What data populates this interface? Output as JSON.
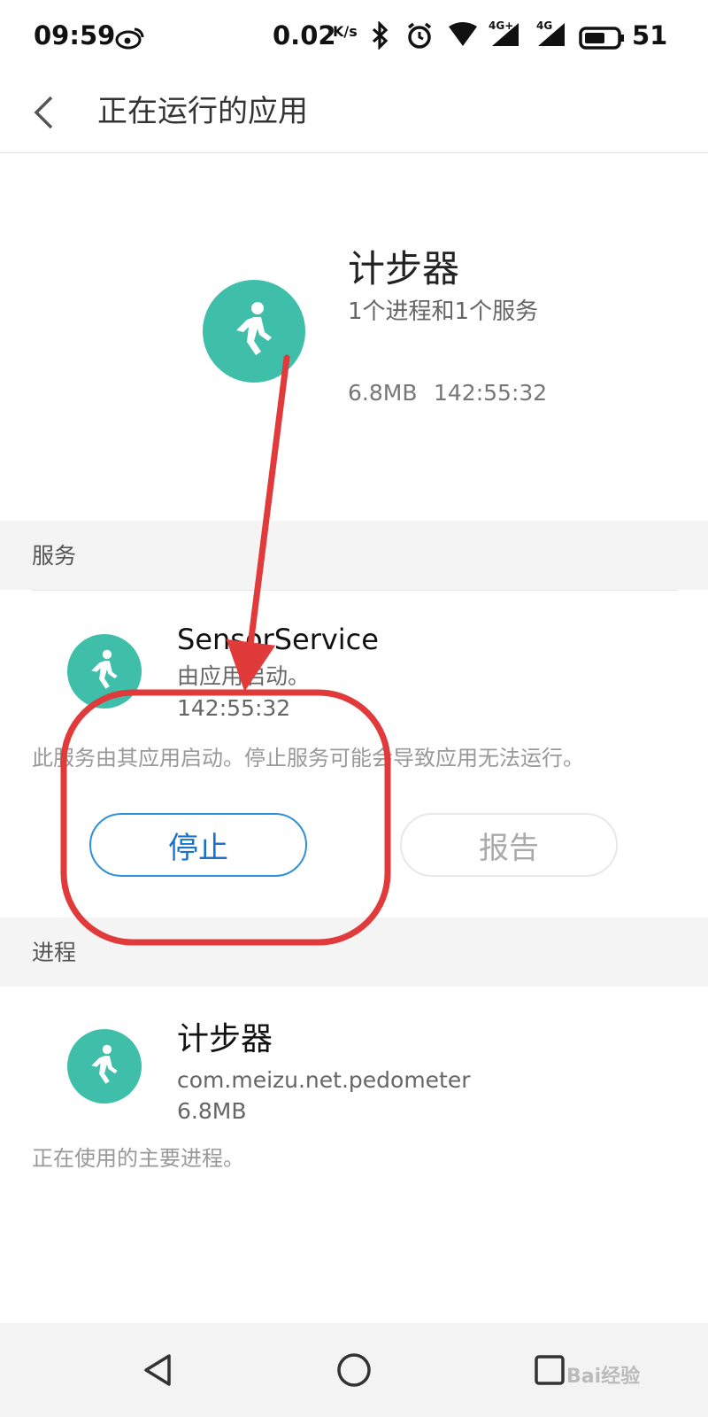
{
  "status_bar": {
    "time": "09:59",
    "net_speed": "0.02",
    "net_unit": "K/s",
    "battery": "51",
    "signal1_label": "4G+",
    "signal2_label": "4G",
    "icons": [
      "weibo-icon",
      "bluetooth-icon",
      "alarm-icon",
      "wifi-icon",
      "signal-icon",
      "signal-icon",
      "battery-icon"
    ]
  },
  "header": {
    "title": "正在运行的应用"
  },
  "app": {
    "name": "计步器",
    "subtitle": "1个进程和1个服务",
    "size": "6.8MB",
    "time": "142:55:32",
    "icon": "walking-person-icon",
    "icon_color": "#3fbfa9"
  },
  "services_section": {
    "title": "服务",
    "service": {
      "name": "SensorService",
      "started_by": "由应用启动。",
      "time": "142:55:32",
      "description": "此服务由其应用启动。停止服务可能会导致应用无法运行。",
      "stop_label": "停止",
      "report_label": "报告"
    }
  },
  "process_section": {
    "title": "进程",
    "process": {
      "name": "计步器",
      "package": "com.meizu.net.pedometer",
      "size": "6.8MB",
      "description": "正在使用的主要进程。"
    }
  },
  "nav_bar": {
    "watermark": "Bai经验",
    "icons": [
      "nav-back-icon",
      "nav-home-icon",
      "nav-recents-icon"
    ]
  },
  "colors": {
    "accent": "#1a73c9",
    "teal": "#3fbfa9",
    "annotation": "#e03a3a"
  }
}
